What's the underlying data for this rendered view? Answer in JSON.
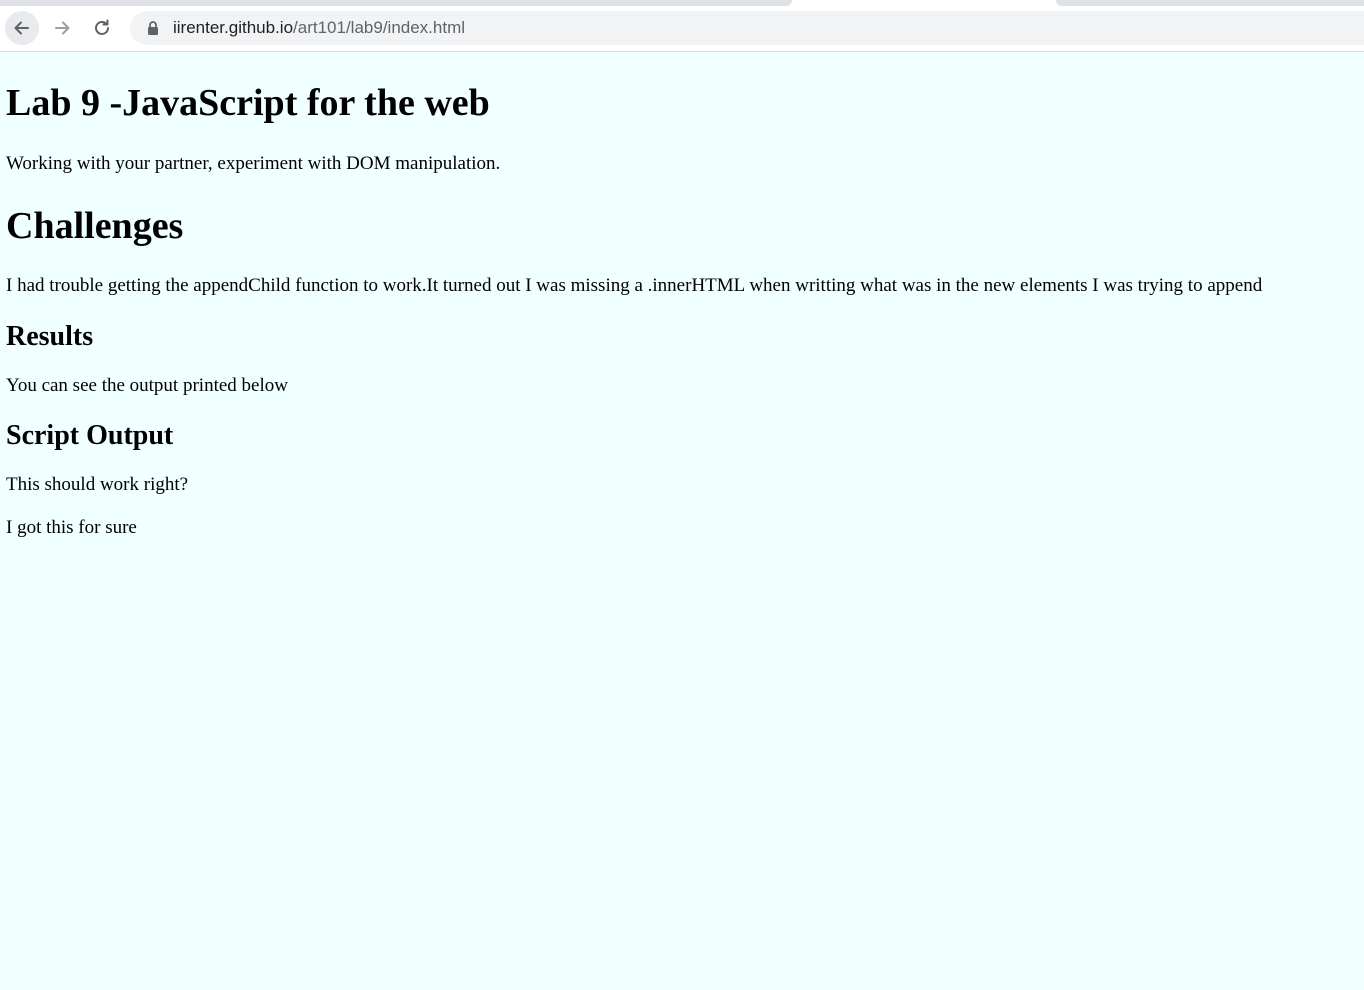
{
  "browser": {
    "url_host": "iirenter.github.io",
    "url_path": "/art101/lab9/index.html"
  },
  "page": {
    "title": "Lab 9 -JavaScript for the web",
    "intro": "Working with your partner, experiment with DOM manipulation.",
    "challenges_heading": "Challenges",
    "challenges_text": "I had trouble getting the appendChild function to work.It turned out I was missing a .innerHTML when writting what was in the new elements I was trying to append",
    "results_heading": "Results",
    "results_text": "You can see the output printed below",
    "output_heading": "Script Output",
    "output_lines": [
      "This should work right?",
      "I got this for sure"
    ]
  },
  "colors": {
    "page_background": "#f0ffff",
    "omnibox_background": "#f1f3f4"
  },
  "icons": {
    "back": "arrow-left-icon",
    "forward": "arrow-right-icon",
    "reload": "reload-icon",
    "lock": "lock-icon"
  }
}
